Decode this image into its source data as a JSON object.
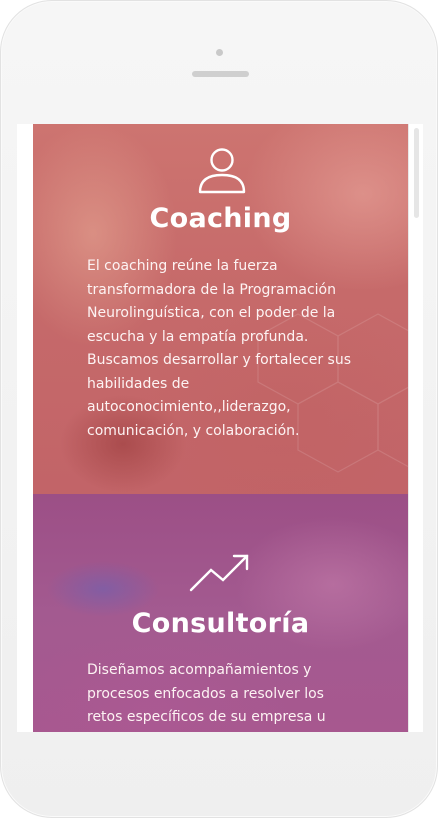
{
  "sections": [
    {
      "title": "Coaching",
      "icon": "user-icon",
      "body": "El coaching reúne la fuerza transformadora de la Programación Neurolinguística, con el poder de la escucha y la empatía profunda. Buscamos desarrollar y fortalecer sus habilidades de autoconocimiento,,liderazgo, comunicación, y colaboración."
    },
    {
      "title": "Consultoría",
      "icon": "trending-up-icon",
      "body": "Diseñamos acompañamientos y procesos enfocados a resolver los retos específicos de su empresa u"
    }
  ],
  "colors": {
    "coaching_overlay": "#c66a6a",
    "consultoria_overlay": "#a35a90",
    "text": "#ffffff",
    "device_frame": "#f2f2f2"
  }
}
